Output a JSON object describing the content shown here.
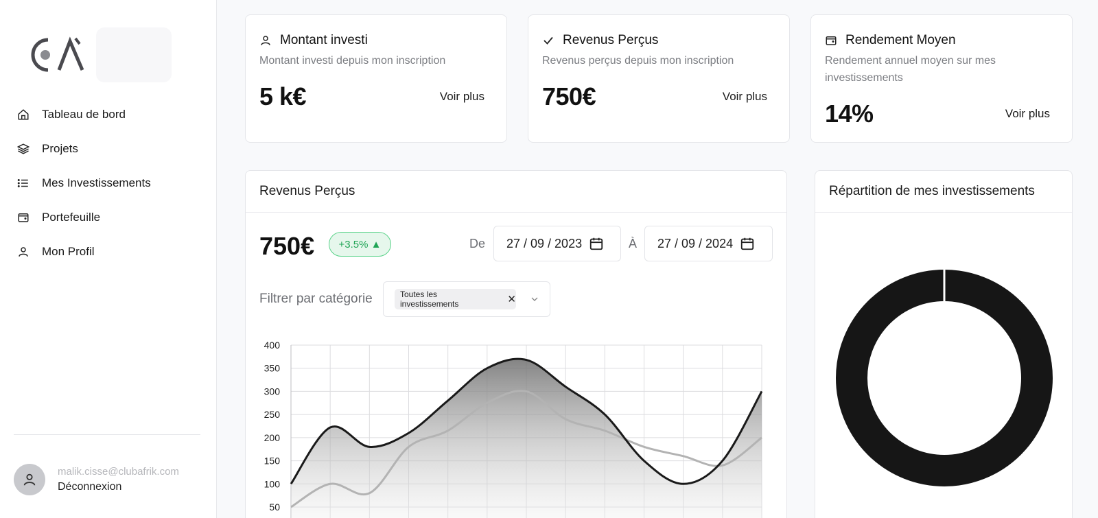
{
  "sidebar": {
    "items": [
      {
        "label": "Tableau de bord",
        "icon": "home-icon"
      },
      {
        "label": "Projets",
        "icon": "layers-icon"
      },
      {
        "label": "Mes Investissements",
        "icon": "list-icon"
      },
      {
        "label": "Portefeuille",
        "icon": "wallet-icon"
      },
      {
        "label": "Mon Profil",
        "icon": "user-icon"
      }
    ],
    "user": {
      "email": "malik.cisse@clubafrik.com",
      "logout": "Déconnexion"
    }
  },
  "cards": [
    {
      "title": "Montant investi",
      "subtitle": "Montant investi depuis mon inscription",
      "value": "5 k€",
      "link": "Voir plus",
      "icon": "user-icon"
    },
    {
      "title": "Revenus Perçus",
      "subtitle": "Revenus perçus depuis mon inscription",
      "value": "750€",
      "link": "Voir plus",
      "icon": "check-icon"
    },
    {
      "title": "Rendement Moyen",
      "subtitle": "Rendement annuel moyen sur mes investissements",
      "value": "14%",
      "link": "Voir plus",
      "icon": "wallet-icon"
    }
  ],
  "revenue_panel": {
    "title": "Revenus Perçus",
    "value": "750€",
    "badge": "+3.5% ▲",
    "from_label": "De",
    "from_date": "27 / 09 / 2023",
    "to_label": "À",
    "to_date": "27 / 09 / 2024",
    "filter_label": "Filtrer par catégorie",
    "filter_chip": "Toutes les investissements",
    "chip_close": "✕"
  },
  "donut_panel": {
    "title": "Répartition de mes investissements"
  },
  "colors": {
    "accent_green": "#1fa455",
    "dark_series": "#1a1a1a",
    "light_series": "#b3b3b3",
    "donut": "#161616"
  },
  "chart_data": {
    "type": "area",
    "ylim": [
      50,
      400
    ],
    "yticks": [
      400,
      350,
      300,
      250,
      200,
      150,
      100,
      50
    ],
    "x": [
      0,
      1,
      2,
      3,
      4,
      5,
      6,
      7,
      8,
      9,
      10,
      11,
      12
    ],
    "grid": true,
    "series": [
      {
        "values": [
          100,
          222,
          180,
          210,
          280,
          350,
          368,
          310,
          250,
          150,
          100,
          150,
          300
        ]
      },
      {
        "values": [
          50,
          100,
          80,
          180,
          215,
          275,
          300,
          240,
          215,
          180,
          160,
          140,
          200
        ]
      }
    ]
  },
  "donut_data": {
    "type": "pie",
    "values": [
      100
    ]
  }
}
